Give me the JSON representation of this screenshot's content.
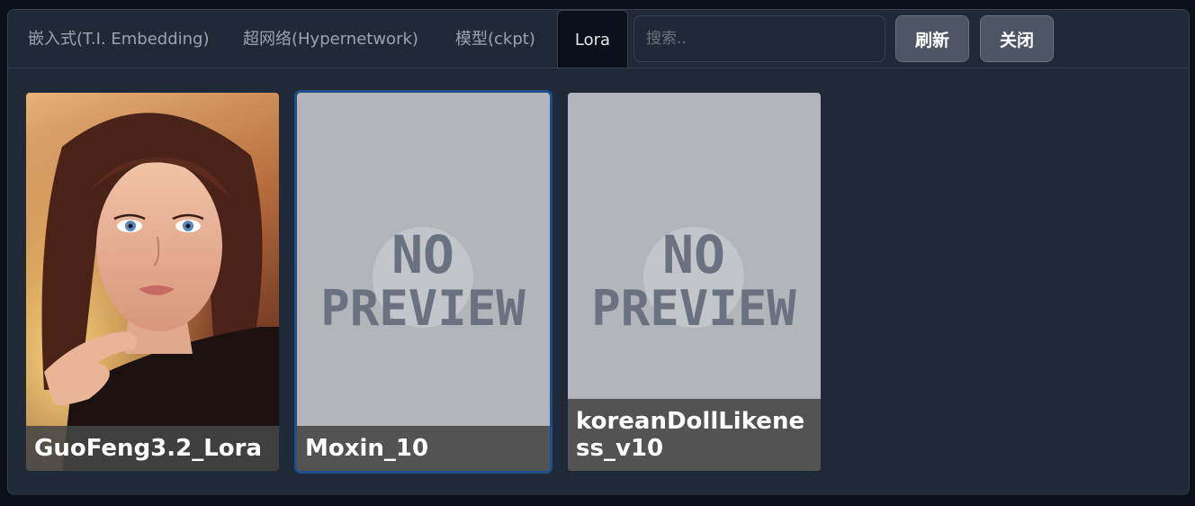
{
  "tabs": [
    {
      "label": "嵌入式(T.I. Embedding)"
    },
    {
      "label": "超网络(Hypernetwork)"
    },
    {
      "label": "模型(ckpt)"
    },
    {
      "label": "Lora"
    }
  ],
  "search": {
    "placeholder": "搜索..",
    "value": ""
  },
  "buttons": {
    "refresh": "刷新",
    "close": "关闭"
  },
  "cards": [
    {
      "name": "GuoFeng3.2_Lora",
      "preview": "portrait"
    },
    {
      "name": "Moxin_10",
      "preview": "no-preview"
    },
    {
      "name": "koreanDollLikeness_v10",
      "preview": "no-preview"
    }
  ],
  "no_preview_text": {
    "line1": "NO",
    "line2": "PREVIEW"
  },
  "colors": {
    "background": "#0b0f19",
    "panel": "#1f2937",
    "selected_border": "#1e4f8c",
    "button": "#4b5563"
  }
}
